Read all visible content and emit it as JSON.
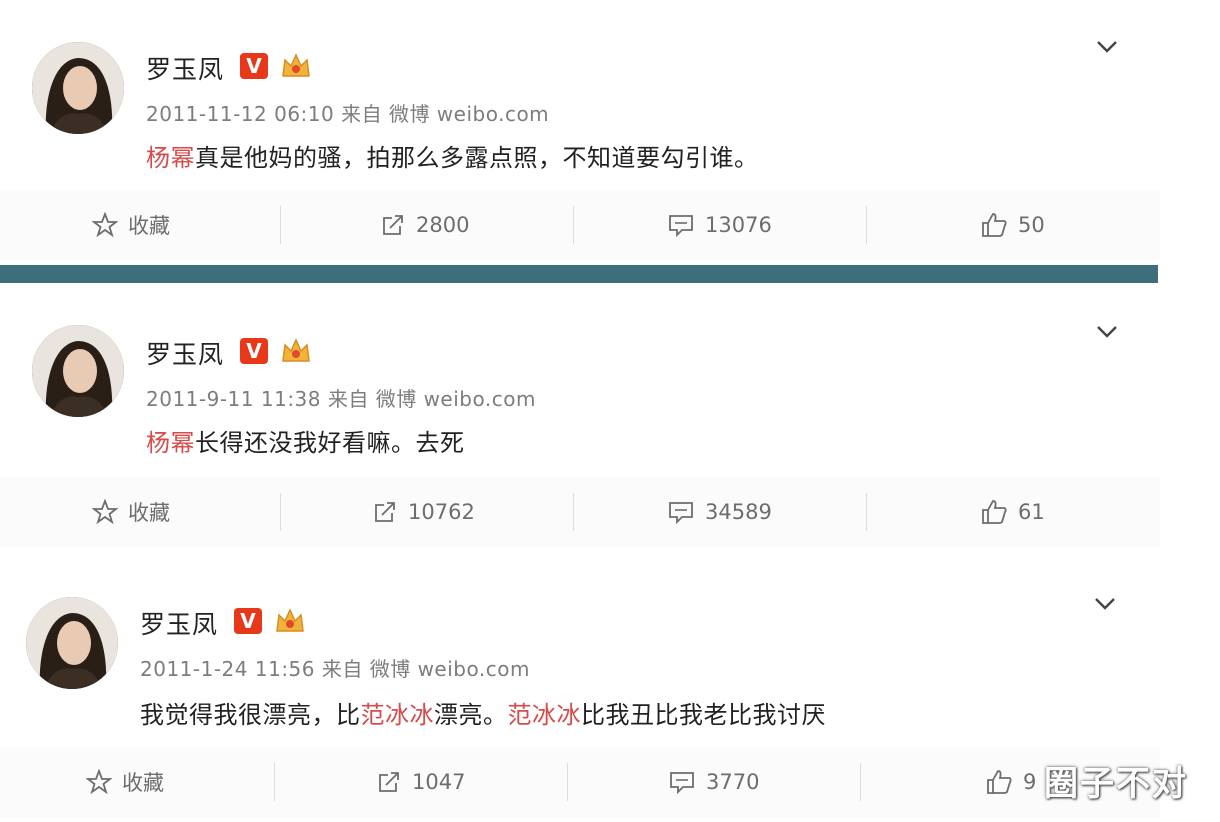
{
  "posts": [
    {
      "username": "罗玉凤",
      "vip_badge": "V",
      "meta": "2011-11-12 06:10 来自 微博 weibo.com",
      "content_parts": [
        {
          "text": "杨幂",
          "highlight": true
        },
        {
          "text": "真是他妈的骚，拍那么多露点照，不知道要勾引谁。",
          "highlight": false
        }
      ],
      "actions": {
        "favorite": "收藏",
        "repost": "2800",
        "comment": "13076",
        "like": "50"
      }
    },
    {
      "username": "罗玉凤",
      "vip_badge": "V",
      "meta": "2011-9-11 11:38 来自 微博 weibo.com",
      "content_parts": [
        {
          "text": "杨幂",
          "highlight": true
        },
        {
          "text": "长得还没我好看嘛。去死",
          "highlight": false
        }
      ],
      "actions": {
        "favorite": "收藏",
        "repost": "10762",
        "comment": "34589",
        "like": "61"
      }
    },
    {
      "username": "罗玉凤",
      "vip_badge": "V",
      "meta": "2011-1-24 11:56 来自 微博 weibo.com",
      "content_parts": [
        {
          "text": "我觉得我很漂亮，比",
          "highlight": false
        },
        {
          "text": "范冰冰",
          "highlight": true
        },
        {
          "text": "漂亮。",
          "highlight": false
        },
        {
          "text": "范冰冰",
          "highlight": true
        },
        {
          "text": "比我丑比我老比我讨厌",
          "highlight": false
        }
      ],
      "actions": {
        "favorite": "收藏",
        "repost": "1047",
        "comment": "3770",
        "like": "9"
      }
    }
  ],
  "watermark": "圈子不对",
  "colors": {
    "highlight": "#d64b4b",
    "vip": "#e8381a",
    "divider": "#3d6e7b"
  },
  "icons": [
    "star-icon",
    "repost-icon",
    "comment-icon",
    "like-icon",
    "chevron-down-icon",
    "crown-icon"
  ]
}
